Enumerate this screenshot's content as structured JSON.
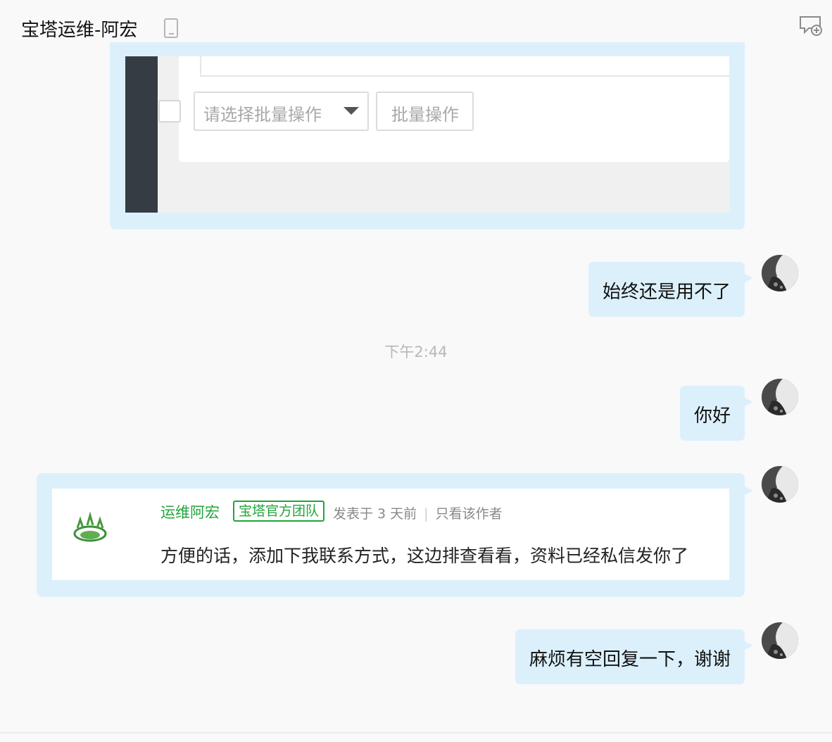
{
  "header": {
    "title": "宝塔运维-阿宏"
  },
  "screenshot_image": {
    "select_placeholder": "请选择批量操作",
    "batch_button_label": "批量操作"
  },
  "messages": [
    {
      "type": "text",
      "text": "始终还是用不了"
    },
    {
      "type": "timestamp",
      "text": "下午2:44"
    },
    {
      "type": "text",
      "text": "你好"
    },
    {
      "type": "quote-card",
      "author": "运维阿宏",
      "badge": "宝塔官方团队",
      "posted": "发表于 3 天前",
      "separator": "|",
      "only_author": "只看该作者",
      "body": "方便的话，添加下我联系方式，这边排查看看，资料已经私信发你了"
    },
    {
      "type": "text",
      "text": "麻烦有空回复一下，谢谢"
    }
  ],
  "colors": {
    "bubble": "#dcf0fc",
    "accent_green": "#20a53a",
    "background": "#f9f9f9"
  }
}
